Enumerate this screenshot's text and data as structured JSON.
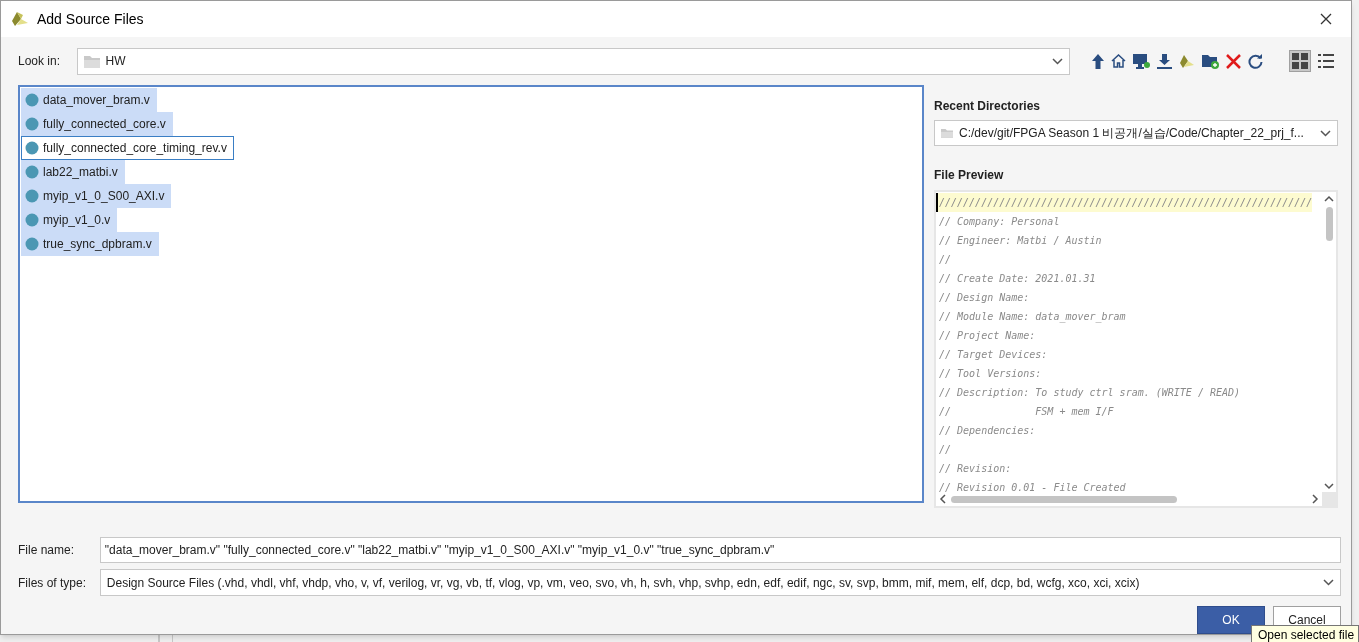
{
  "window": {
    "title": "Add Source Files"
  },
  "look_in": {
    "label": "Look in:",
    "value": "HW"
  },
  "view_modes": [
    {
      "kind": "grid",
      "selected": true
    },
    {
      "kind": "list",
      "selected": false
    }
  ],
  "files": [
    {
      "name": "data_mover_bram.v",
      "selected": true,
      "focused": false
    },
    {
      "name": "fully_connected_core.v",
      "selected": true,
      "focused": false
    },
    {
      "name": "fully_connected_core_timing_rev.v",
      "selected": false,
      "focused": true
    },
    {
      "name": "lab22_matbi.v",
      "selected": true,
      "focused": false
    },
    {
      "name": "myip_v1_0_S00_AXI.v",
      "selected": true,
      "focused": false
    },
    {
      "name": "myip_v1_0.v",
      "selected": true,
      "focused": false
    },
    {
      "name": "true_sync_dpbram.v",
      "selected": true,
      "focused": false
    }
  ],
  "recent_directories": {
    "label": "Recent Directories",
    "value": "C:/dev/git/FPGA Season 1 비공개/실습/Code/Chapter_22_prj_f..."
  },
  "file_preview": {
    "label": "File Preview",
    "lines": [
      "//////////////////////////////////////////////////////////////",
      "// Company: Personal",
      "// Engineer: Matbi / Austin",
      "//",
      "// Create Date: 2021.01.31",
      "// Design Name:",
      "// Module Name: data_mover_bram",
      "// Project Name:",
      "// Target Devices:",
      "// Tool Versions:",
      "// Description: To study ctrl sram. (WRITE / READ)",
      "//              FSM + mem I/F",
      "// Dependencies:",
      "//",
      "// Revision:",
      "// Revision 0.01 - File Created"
    ]
  },
  "file_name": {
    "label": "File name:",
    "value": "\"data_mover_bram.v\" \"fully_connected_core.v\" \"lab22_matbi.v\" \"myip_v1_0_S00_AXI.v\" \"myip_v1_0.v\" \"true_sync_dpbram.v\""
  },
  "files_of_type": {
    "label": "Files of type:",
    "value": "Design Source Files (.vhd, vhdl, vhf, vhdp, vho, v, vf, verilog, vr, vg, vb, tf, vlog, vp, vm, veo, svo, vh, h, svh, vhp, svhp, edn, edf, edif, ngc, sv, svp, bmm, mif, mem, elf, dcp, bd, wcfg, xco, xci, xcix)"
  },
  "buttons": [
    {
      "label": "OK",
      "kind": "primary"
    },
    {
      "label": "Cancel",
      "kind": "secondary"
    }
  ],
  "tooltip": "Open selected file"
}
